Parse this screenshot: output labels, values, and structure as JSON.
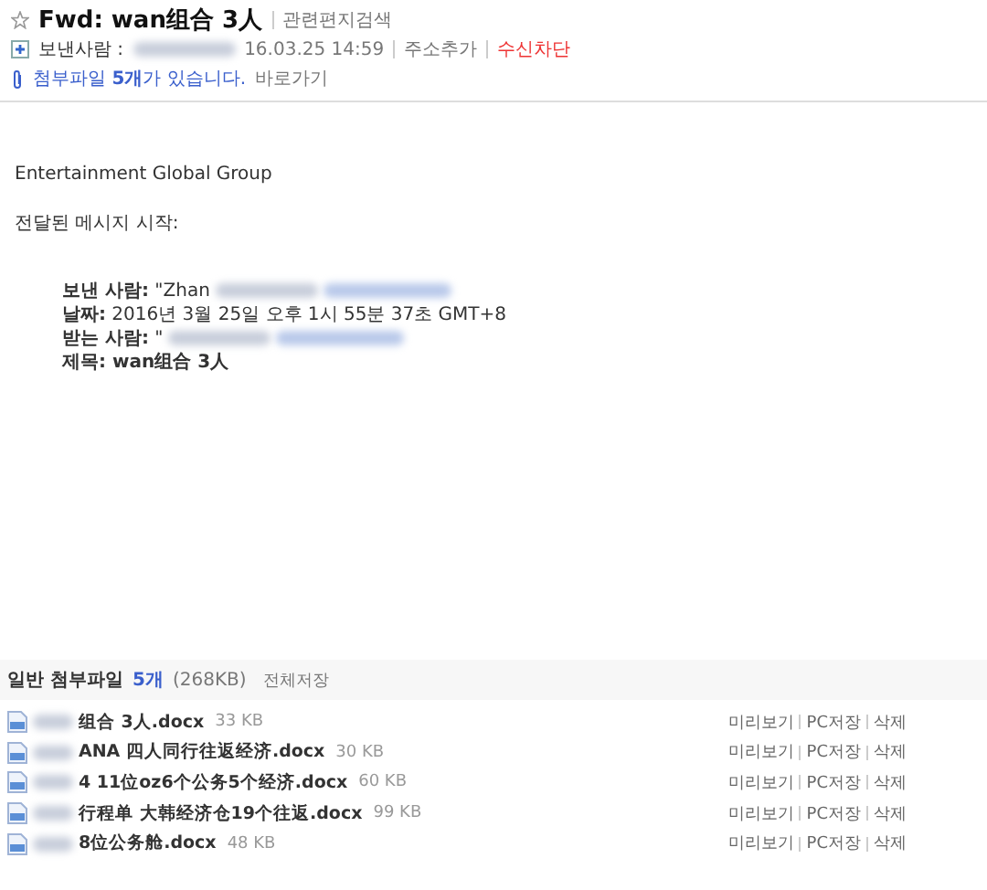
{
  "header": {
    "starred": false,
    "title": "Fwd: wan组合 3人",
    "related_link": "관련편지검색",
    "sender_label": "보낸사람 :",
    "date": "16.03.25 14:59",
    "actions": [
      {
        "label": "주소추가",
        "kind": "normal"
      },
      {
        "label": "수신차단",
        "kind": "danger"
      }
    ],
    "attachment_notice": {
      "prefix": "첨부파일 ",
      "count": "5개",
      "suffix": "가 있습니다.",
      "link": "바로가기"
    }
  },
  "body": {
    "lines": [
      "Entertainment Global Group",
      "전달된 메시지 시작:"
    ],
    "forwarded": [
      {
        "text": "**보낸 사람:** \"Zhan",
        "redacted": true
      },
      {
        "text": "**날짜:** 2016년 3월 25일 오후 1시 55분 37초 GMT+8",
        "redacted": false
      },
      {
        "text": "**받는 사람:** \"",
        "redacted": true
      },
      {
        "text": "**제목: wan组合 3人**",
        "redacted": false
      }
    ]
  },
  "attachments": {
    "title": "일반 첨부파일",
    "count": "5개",
    "size": "(268KB)",
    "save_all": "전체저장",
    "files": [
      {
        "name": "组合 3人.docx",
        "size": "33 KB",
        "actions": [
          "미리보기",
          "PC저장",
          "삭제"
        ]
      },
      {
        "name": "ANA 四人同行往返经济.docx",
        "size": "30 KB",
        "actions": [
          "미리보기",
          "PC저장",
          "삭제"
        ]
      },
      {
        "name": "4 11位oz6个公务5个经济.docx",
        "size": "60 KB",
        "actions": [
          "미리보기",
          "PC저장",
          "삭제"
        ]
      },
      {
        "name": "行程单 大韩经济仓19个往返.docx",
        "size": "99 KB",
        "actions": [
          "미리보기",
          "PC저장",
          "삭제"
        ]
      },
      {
        "name": " 8位公务舱.docx",
        "size": "48 KB",
        "actions": [
          "미리보기",
          "PC저장",
          "삭제"
        ]
      }
    ]
  }
}
